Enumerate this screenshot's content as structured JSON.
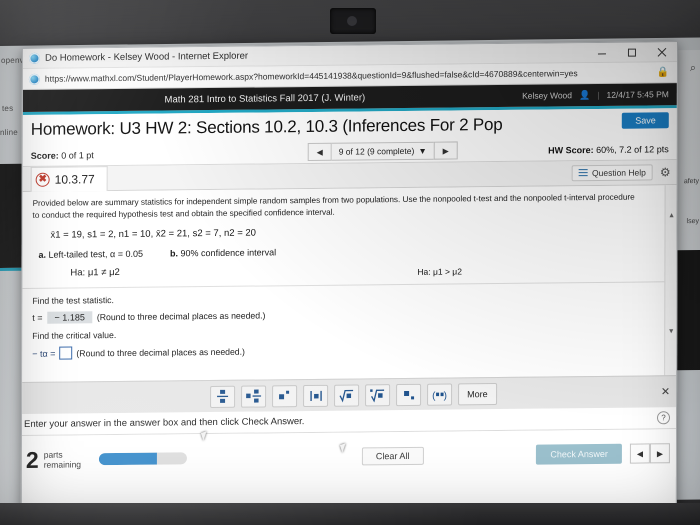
{
  "window": {
    "title": "Do Homework - Kelsey Wood - Internet Explorer",
    "url": "https://www.mathxl.com/Student/PlayerHomework.aspx?homeworkId=445141938&questionId=9&flushed=false&cId=4670889&centerwin=yes",
    "controls": {
      "minimize": "minimize-icon",
      "maximize": "maximize-icon",
      "close": "close-icon"
    },
    "lock_icon": "lock-icon"
  },
  "course_bar": {
    "title": "Math 281 Intro to Statistics Fall 2017 (J. Winter)",
    "user": "Kelsey Wood",
    "user_icon": "person-icon",
    "timestamp": "12/4/17 5:45 PM"
  },
  "header": {
    "homework_title": "Homework: U3 HW 2: Sections 10.2, 10.3 (Inferences For 2 Pop",
    "save_label": "Save",
    "score_label": "Score:",
    "score_value": "0 of 1 pt",
    "question_nav": {
      "prev_icon": "left-arrow-icon",
      "next_icon": "right-arrow-icon",
      "selected": "9 of 12 (9 complete)",
      "caret_icon": "chevron-down-icon"
    },
    "hw_score_label": "HW Score:",
    "hw_score_value": "60%, 7.2 of 12 pts"
  },
  "question": {
    "status_icon": "incorrect-x-icon",
    "id": "10.3.77",
    "help_label": "Question Help",
    "help_icon": "list-icon",
    "gear_icon": "gear-icon"
  },
  "problem": {
    "statement_line1": "Provided below are summary statistics for independent simple random samples from two populations. Use the nonpooled t-test and the nonpooled t-interval procedure",
    "statement_line2": "to conduct the required hypothesis test and obtain the specified confidence interval.",
    "stats": "x̄1 = 19, s1 = 2, n1 = 10, x̄2 = 21, s2 = 7, n2 = 20",
    "part_a_label": "a.",
    "part_a_text": "Left-tailed test, α = 0.05",
    "part_b_label": "b.",
    "part_b_text": "90% confidence interval",
    "hypothesis_left": "Ha: μ1 ≠ μ2",
    "hypothesis_right": "Ha: μ1 > μ2",
    "prompt_test_statistic": "Find the test statistic.",
    "t_label": "t =",
    "t_value": "− 1.185",
    "t_note": "(Round to three decimal places as needed.)",
    "prompt_critical_value": "Find the critical value.",
    "crit_label": "− tα =",
    "crit_value": "",
    "crit_note": "(Round to three decimal places as needed.)"
  },
  "palette": {
    "buttons": [
      {
        "name": "fraction-button",
        "glyph": "fraction-icon"
      },
      {
        "name": "mixed-number-button",
        "glyph": "mixed-number-icon"
      },
      {
        "name": "exponent-button",
        "glyph": "exponent-icon"
      },
      {
        "name": "absolute-value-button",
        "glyph": "absolute-value-icon"
      },
      {
        "name": "square-root-button",
        "glyph": "sqrt-icon"
      },
      {
        "name": "nth-root-button",
        "glyph": "nth-root-icon"
      },
      {
        "name": "subscript-button",
        "glyph": "subscript-icon"
      },
      {
        "name": "interval-notation-button",
        "glyph": "interval-icon"
      }
    ],
    "more_label": "More",
    "close_icon": "close-icon"
  },
  "footer": {
    "instruction": "Enter your answer in the answer box and then click Check Answer.",
    "help_icon": "question-mark-icon",
    "parts_number": "2",
    "parts_label_line1": "parts",
    "parts_label_line2": "remaining",
    "progress_percent": 66,
    "clear_all_label": "Clear All",
    "check_answer_label": "Check Answer",
    "prev_icon": "left-arrow-icon",
    "next_icon": "right-arrow-icon"
  },
  "background": {
    "left_fragments": [
      "openvell",
      "tes",
      "nline"
    ],
    "right_fragments": [
      "afety",
      "lsey"
    ],
    "search_icon": "search-icon"
  },
  "colors": {
    "accent_blue": "#1b7ec4",
    "teal": "#22a8c4",
    "progress_blue": "#2e86c8",
    "check_answer": "#9bc0cd",
    "error_red": "#c0392b"
  }
}
